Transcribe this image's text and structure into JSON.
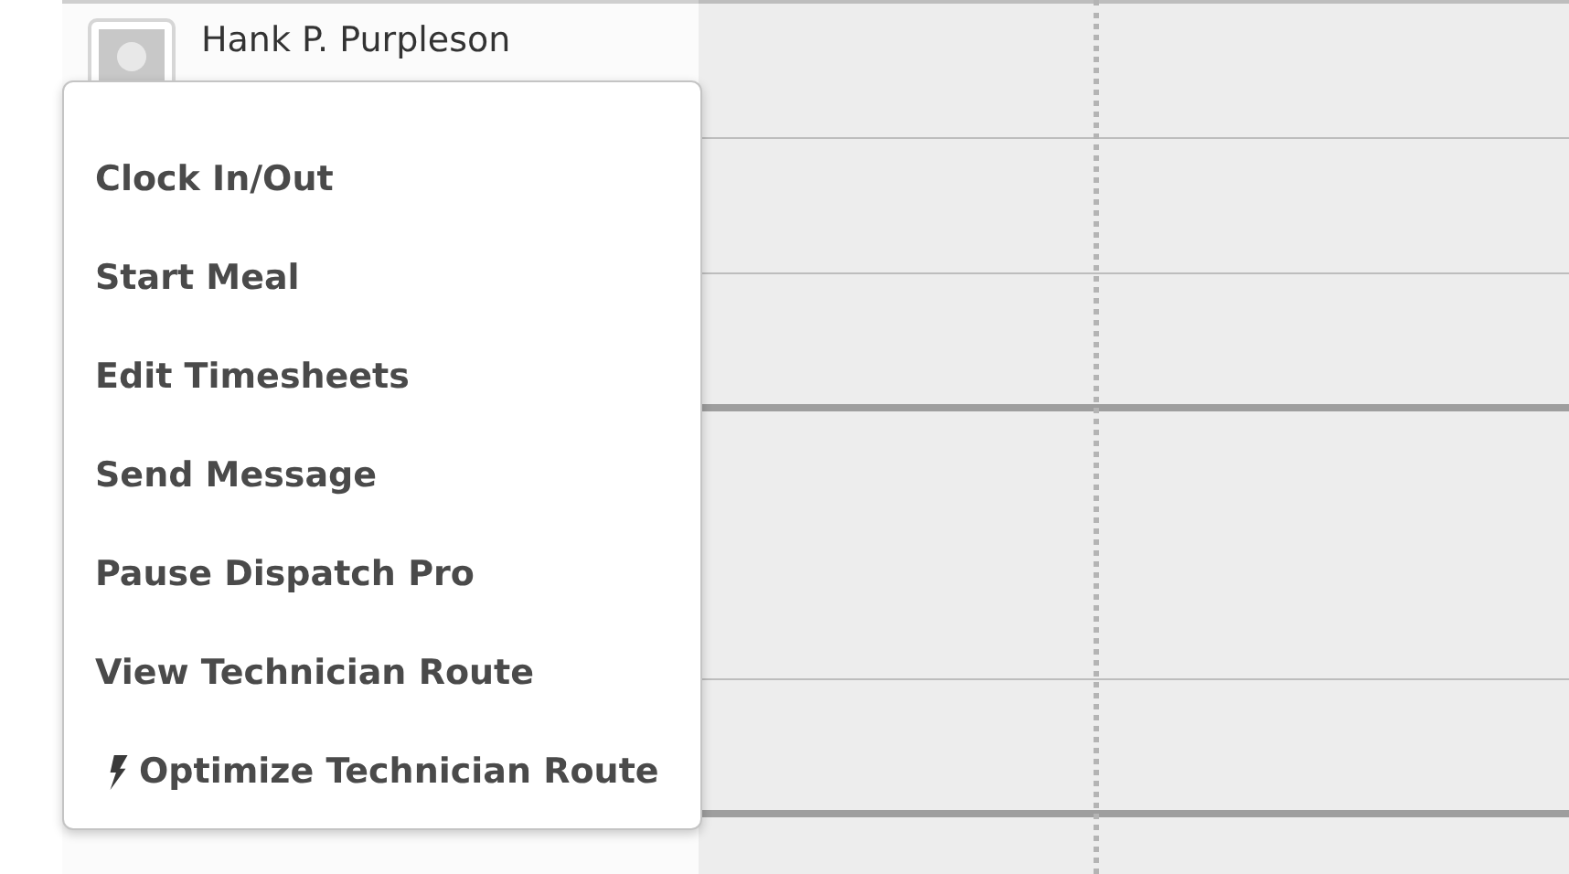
{
  "technician": {
    "name": "Hank P. Purpleson"
  },
  "context_menu": {
    "items": [
      {
        "label": "Clock In/Out",
        "kind": "plain"
      },
      {
        "label": "Start Meal",
        "kind": "plain"
      },
      {
        "label": "Edit Timesheets",
        "kind": "plain"
      },
      {
        "label": "Send Message",
        "kind": "plain"
      },
      {
        "label": "Pause Dispatch Pro",
        "kind": "plain"
      },
      {
        "label": "View Technician Route",
        "kind": "plain"
      },
      {
        "label": "Optimize Technician Route",
        "kind": "optimize"
      }
    ]
  }
}
